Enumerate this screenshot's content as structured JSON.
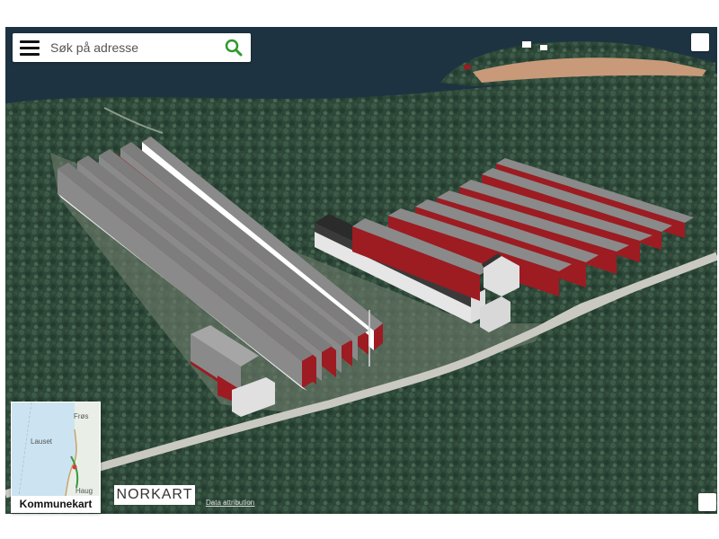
{
  "search": {
    "placeholder": "Søk på adresse",
    "value": "",
    "menu_icon": "hamburger-menu-icon",
    "search_icon": "magnifier-icon",
    "search_icon_color": "#2e9a2e"
  },
  "minimap": {
    "label": "Kommunekart",
    "places": [
      "Frøs",
      "Lauset",
      "Haug"
    ]
  },
  "branding": {
    "logo_text": "NORKART"
  },
  "attribution": {
    "label": "Data attribution"
  },
  "colors": {
    "roof_red": "#9c1c22",
    "roof_gray": "#8a8a8a",
    "forest": "#2f4a3c",
    "water": "#1e3342",
    "road": "#c9c9c2"
  }
}
